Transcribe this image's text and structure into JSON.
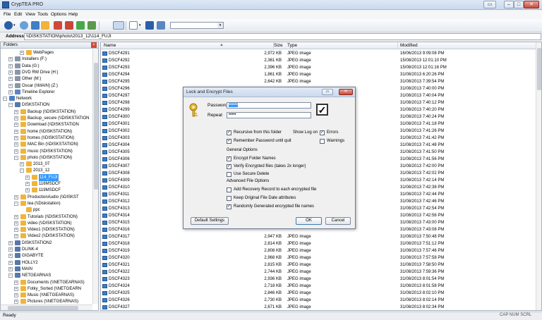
{
  "window": {
    "title": "CrypTEA PRO",
    "controls": {
      "extra": "▭",
      "minimize": "–",
      "maximize": "□",
      "close": "✕"
    }
  },
  "menu": [
    "File",
    "Edit",
    "View",
    "Tools",
    "Options",
    "Help"
  ],
  "toolbar": {
    "colors": {
      "accent": "#2b5ea7",
      "lock": "#d04a3a",
      "green": "#48a84a",
      "folder": "#f0b43b"
    }
  },
  "address": {
    "label": "Address",
    "value": "\\\\DISKSTATION\\photo\\2013_12\\114_FUJI"
  },
  "left": {
    "header": "Folders",
    "close": "×",
    "tree": [
      {
        "label": "WebPages",
        "indent": 4,
        "exp": "+",
        "icon": "folder"
      },
      {
        "label": "Installers (F:)",
        "indent": 2,
        "exp": "+",
        "icon": "drive"
      },
      {
        "label": "Data (G:)",
        "indent": 2,
        "exp": "+",
        "icon": "drive"
      },
      {
        "label": "DVD RW Drive (H:)",
        "indent": 2,
        "exp": "+",
        "icon": "drive"
      },
      {
        "label": "Other (M:)",
        "indent": 2,
        "exp": "+",
        "icon": "drive"
      },
      {
        "label": "Oscar (\\\\MAIN) (Z:)",
        "indent": 2,
        "exp": "+",
        "icon": "drive"
      },
      {
        "label": "Timeline Explorer",
        "indent": 2,
        "exp": "+",
        "icon": "app"
      },
      {
        "label": "Network",
        "indent": 1,
        "exp": "−",
        "icon": "network"
      },
      {
        "label": "DISKSTATION",
        "indent": 2,
        "exp": "−",
        "icon": "computer"
      },
      {
        "label": "Backup (\\\\DISKSTATION)",
        "indent": 3,
        "exp": "+",
        "icon": "folder"
      },
      {
        "label": "Backup_secure (\\\\DISKSTATION",
        "indent": 3,
        "exp": "+",
        "icon": "folder"
      },
      {
        "label": "Download (\\\\DISKSTATION",
        "indent": 3,
        "exp": "+",
        "icon": "folder"
      },
      {
        "label": "home (\\\\DISKSTATION)",
        "indent": 3,
        "exp": "+",
        "icon": "folder"
      },
      {
        "label": "homes (\\\\DISKSTATION)",
        "indent": 3,
        "exp": "+",
        "icon": "folder"
      },
      {
        "label": "MAC Bin (\\\\DISKSTATION)",
        "indent": 3,
        "exp": "+",
        "icon": "folder"
      },
      {
        "label": "music (\\\\DISKSTATION)",
        "indent": 3,
        "exp": "+",
        "icon": "folder"
      },
      {
        "label": "photo (\\\\DISKSTATION)",
        "indent": 3,
        "exp": "−",
        "icon": "folder"
      },
      {
        "label": "2013_07",
        "indent": 4,
        "exp": "+",
        "icon": "folder"
      },
      {
        "label": "2013_12",
        "indent": 4,
        "exp": "−",
        "icon": "folder"
      },
      {
        "label": "114_FUJI",
        "indent": 5,
        "exp": "+",
        "icon": "folder",
        "selected": true
      },
      {
        "label": "116MSDCF",
        "indent": 5,
        "exp": "+",
        "icon": "folder"
      },
      {
        "label": "119MSDCF",
        "indent": 5,
        "exp": "+",
        "icon": "folder"
      },
      {
        "label": "ProductionAudio (\\\\DISKST",
        "indent": 3,
        "exp": "+",
        "icon": "folder"
      },
      {
        "label": "tea (\\\\Diskstation)",
        "indent": 3,
        "exp": "−",
        "icon": "folder"
      },
      {
        "label": "ppc",
        "indent": 4,
        "exp": "",
        "icon": "folder"
      },
      {
        "label": "Tutorials (\\\\DISKSTATION)",
        "indent": 3,
        "exp": "+",
        "icon": "folder"
      },
      {
        "label": "video (\\\\DISKSTATION)",
        "indent": 3,
        "exp": "+",
        "icon": "folder"
      },
      {
        "label": "Video1 (\\\\DISKSTATION)",
        "indent": 3,
        "exp": "+",
        "icon": "folder"
      },
      {
        "label": "Video2 (\\\\DISKSTATION)",
        "indent": 3,
        "exp": "+",
        "icon": "folder"
      },
      {
        "label": "DISKSTATION2",
        "indent": 2,
        "exp": "+",
        "icon": "computer"
      },
      {
        "label": "DLINK-4",
        "indent": 2,
        "exp": "+",
        "icon": "computer"
      },
      {
        "label": "GIGABYTE",
        "indent": 2,
        "exp": "+",
        "icon": "computer"
      },
      {
        "label": "HOLLY2",
        "indent": 2,
        "exp": "+",
        "icon": "computer"
      },
      {
        "label": "MAIN",
        "indent": 2,
        "exp": "+",
        "icon": "computer"
      },
      {
        "label": "NETGEARNAS",
        "indent": 2,
        "exp": "−",
        "icon": "computer"
      },
      {
        "label": "Documents (\\\\NETGEARNAS)",
        "indent": 3,
        "exp": "+",
        "icon": "folder"
      },
      {
        "label": "Fotky_Sorted (\\\\NETGEARN",
        "indent": 3,
        "exp": "+",
        "icon": "folder"
      },
      {
        "label": "Music (\\\\NETGEARNAS)",
        "indent": 3,
        "exp": "+",
        "icon": "folder"
      },
      {
        "label": "Pictures (\\\\NETGEARNAS)",
        "indent": 3,
        "exp": "+",
        "icon": "folder"
      }
    ]
  },
  "list": {
    "columns": {
      "name": "Name",
      "size": "Size",
      "type": "Type",
      "modified": "Modified"
    },
    "files": [
      {
        "name": "DSCF4291",
        "size": "2,972 KB",
        "type": "JPEG image",
        "modified": "16/06/2013 9:09:08 PM"
      },
      {
        "name": "DSCF4292",
        "size": "2,361 KB",
        "type": "JPEG image",
        "modified": "15/08/2013 12:01:10 PM"
      },
      {
        "name": "DSCF4293",
        "size": "2,396 KB",
        "type": "JPEG image",
        "modified": "15/08/2013 12:01:16 PM"
      },
      {
        "name": "DSCF4294",
        "size": "1,861 KB",
        "type": "JPEG image",
        "modified": "31/08/2013 6:20:26 PM"
      },
      {
        "name": "DSCF4295",
        "size": "2,642 KB",
        "type": "JPEG image",
        "modified": "31/08/2013 7:39:54 PM"
      },
      {
        "name": "DSCF4296",
        "size": "",
        "type": "",
        "modified": "31/08/2013 7:40:00 PM"
      },
      {
        "name": "DSCF4297",
        "size": "",
        "type": "",
        "modified": "31/08/2013 7:40:04 PM"
      },
      {
        "name": "DSCF4298",
        "size": "",
        "type": "",
        "modified": "31/08/2013 7:40:12 PM"
      },
      {
        "name": "DSCF4299",
        "size": "",
        "type": "",
        "modified": "31/08/2013 7:40:20 PM"
      },
      {
        "name": "DSCF4300",
        "size": "",
        "type": "",
        "modified": "31/08/2013 7:40:24 PM"
      },
      {
        "name": "DSCF4301",
        "size": "",
        "type": "",
        "modified": "31/08/2013 7:41:18 PM"
      },
      {
        "name": "DSCF4302",
        "size": "",
        "type": "",
        "modified": "31/08/2013 7:41:26 PM"
      },
      {
        "name": "DSCF4303",
        "size": "",
        "type": "",
        "modified": "31/08/2013 7:41:42 PM"
      },
      {
        "name": "DSCF4304",
        "size": "",
        "type": "",
        "modified": "31/08/2013 7:41:48 PM"
      },
      {
        "name": "DSCF4305",
        "size": "",
        "type": "",
        "modified": "31/08/2013 7:41:50 PM"
      },
      {
        "name": "DSCF4306",
        "size": "",
        "type": "",
        "modified": "31/08/2013 7:41:56 PM"
      },
      {
        "name": "DSCF4307",
        "size": "",
        "type": "",
        "modified": "31/08/2013 7:42:00 PM"
      },
      {
        "name": "DSCF4308",
        "size": "",
        "type": "",
        "modified": "31/08/2013 7:42:02 PM"
      },
      {
        "name": "DSCF4309",
        "size": "",
        "type": "",
        "modified": "31/08/2013 7:42:14 PM"
      },
      {
        "name": "DSCF4310",
        "size": "",
        "type": "",
        "modified": "31/08/2013 7:42:38 PM"
      },
      {
        "name": "DSCF4311",
        "size": "",
        "type": "",
        "modified": "31/08/2013 7:42:44 PM"
      },
      {
        "name": "DSCF4312",
        "size": "",
        "type": "",
        "modified": "31/08/2013 7:42:46 PM"
      },
      {
        "name": "DSCF4313",
        "size": "",
        "type": "",
        "modified": "31/08/2013 7:42:54 PM"
      },
      {
        "name": "DSCF4314",
        "size": "",
        "type": "",
        "modified": "31/08/2013 7:42:56 PM"
      },
      {
        "name": "DSCF4315",
        "size": "",
        "type": "",
        "modified": "31/08/2013 7:43:00 PM"
      },
      {
        "name": "DSCF4316",
        "size": "",
        "type": "",
        "modified": "31/08/2013 7:43:08 PM"
      },
      {
        "name": "DSCF4317",
        "size": "2,947 KB",
        "type": "JPEG image",
        "modified": "31/08/2013 7:50:48 PM"
      },
      {
        "name": "DSCF4318",
        "size": "2,814 KB",
        "type": "JPEG image",
        "modified": "31/08/2013 7:51:12 PM"
      },
      {
        "name": "DSCF4319",
        "size": "2,808 KB",
        "type": "JPEG image",
        "modified": "31/08/2013 7:57:46 PM"
      },
      {
        "name": "DSCF4320",
        "size": "2,968 KB",
        "type": "JPEG image",
        "modified": "31/08/2013 7:57:58 PM"
      },
      {
        "name": "DSCF4321",
        "size": "2,815 KB",
        "type": "JPEG image",
        "modified": "31/08/2013 7:58:50 PM"
      },
      {
        "name": "DSCF4322",
        "size": "2,744 KB",
        "type": "JPEG image",
        "modified": "31/08/2013 7:59:36 PM"
      },
      {
        "name": "DSCF4323",
        "size": "2,936 KB",
        "type": "JPEG image",
        "modified": "31/08/2013 8:01:54 PM"
      },
      {
        "name": "DSCF4324",
        "size": "2,718 KB",
        "type": "JPEG image",
        "modified": "31/08/2013 8:01:58 PM"
      },
      {
        "name": "DSCF4325",
        "size": "2,846 KB",
        "type": "JPEG image",
        "modified": "31/08/2013 8:02:10 PM"
      },
      {
        "name": "DSCF4326",
        "size": "2,730 KB",
        "type": "JPEG image",
        "modified": "31/08/2013 8:02:14 PM"
      },
      {
        "name": "DSCF4327",
        "size": "2,671 KB",
        "type": "JPEG image",
        "modified": "31/08/2013 8:02:34 PM"
      }
    ]
  },
  "status": {
    "ready": "Ready",
    "keys": "CAP  NUM  SCRL"
  },
  "dialog": {
    "title": "Lock and Encrypt Files",
    "password_label": "Password",
    "password_value": "••••••",
    "repeat_label": "Repeat",
    "repeat_value": "•••••",
    "bigcheck": "✓",
    "show_log_label": "Show Log on",
    "check_mark": "✓",
    "options": {
      "recursive": {
        "label": "Recursive from this folder",
        "checked": true
      },
      "remember": {
        "label": "Remember Password until quit",
        "checked": true
      },
      "errors": {
        "label": "Errors",
        "checked": true
      },
      "warnings": {
        "label": "Warnings",
        "checked": false
      },
      "general_options_label": "General Options",
      "encrypt_names": {
        "label": "Encrypt Folder Names",
        "checked": true
      },
      "verify": {
        "label": "Verify Encrypted files (takes 2x longer)",
        "checked": true
      },
      "secure_delete": {
        "label": "Use Secure Delete",
        "checked": false
      },
      "advanced_label": "Advanced File Options",
      "recovery": {
        "label": "Add Recovery Record to each encrypted file",
        "checked": false
      },
      "keep_date": {
        "label": "Keep Original File Date attributes",
        "checked": false
      },
      "random_names": {
        "label": "Randomly Generated encrypted file names",
        "checked": true
      }
    },
    "buttons": {
      "defaults": "Default Settings",
      "ok": "OK",
      "cancel": "Cancel"
    }
  }
}
